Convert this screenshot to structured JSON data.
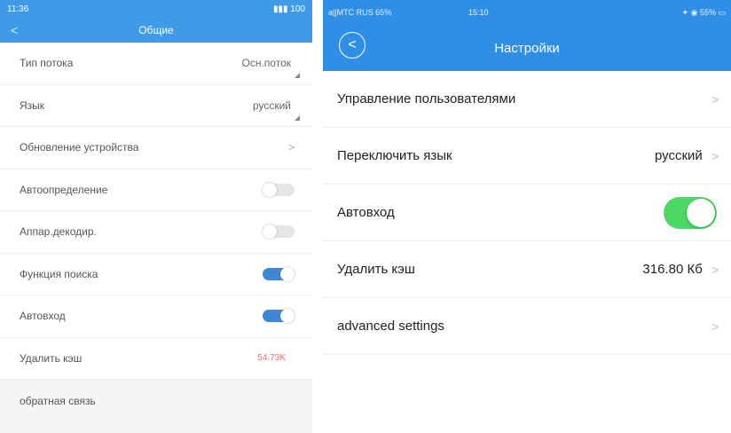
{
  "left": {
    "statusbar": {
      "time": "11:36",
      "signal": "▾",
      "battery": "▮▮▮ 100"
    },
    "navbar": {
      "back": "<",
      "title": "Общие"
    },
    "rows": [
      {
        "label": "Тип потока",
        "value": "Осн.поток",
        "kind": "select"
      },
      {
        "label": "Язык",
        "value": "русский",
        "kind": "select"
      },
      {
        "label": "Обновление устройства",
        "kind": "chevron"
      },
      {
        "label": "Автоопределение",
        "kind": "toggle",
        "on": false
      },
      {
        "label": "Аппар.декодир.",
        "kind": "toggle",
        "on": false
      },
      {
        "label": "Функция поиска",
        "kind": "toggle",
        "on": true
      },
      {
        "label": "Автовход",
        "kind": "toggle",
        "on": true
      },
      {
        "label": "Удалить кэш",
        "value": "54.73K",
        "kind": "value"
      },
      {
        "label": "обратная связь",
        "kind": "plain"
      }
    ],
    "chevron": ">",
    "colors": {
      "accent": "#3f9ae8",
      "toggle_on": "#3f87d6",
      "cache_value": "#e07070"
    }
  },
  "right": {
    "statusbar": {
      "left": "a||МТС RUS 65%",
      "time": "15:10",
      "right": "✦ ◉ 55% ▭"
    },
    "navbar": {
      "back": "<",
      "title": "Настройки"
    },
    "rows": [
      {
        "label": "Управление пользователями",
        "kind": "chevron"
      },
      {
        "label": "Переключить язык",
        "value": "русский",
        "kind": "value"
      },
      {
        "label": "Автовход",
        "kind": "toggle",
        "on": true
      },
      {
        "label": "Удалить кэш",
        "value": "316.80 Кб",
        "kind": "value"
      },
      {
        "label": "advanced settings",
        "kind": "chevron"
      }
    ],
    "chevron": ">",
    "colors": {
      "accent": "#2f8fe6",
      "toggle_on": "#4cd864"
    }
  }
}
